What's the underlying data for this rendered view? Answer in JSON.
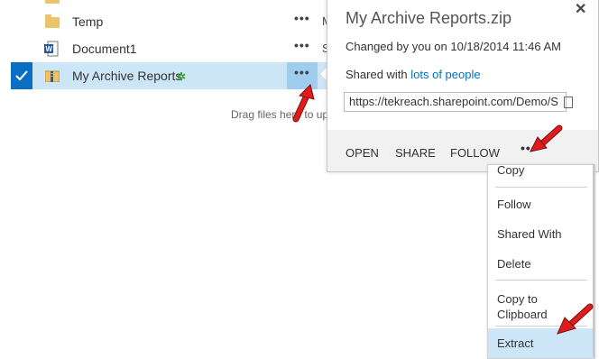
{
  "file_list": {
    "rows": [
      {
        "name": "Temp",
        "icon": "folder-icon",
        "clipped_col": ""
      },
      {
        "name": "Document1",
        "icon": "word-doc-icon",
        "clipped_col": "S"
      },
      {
        "name": "My Archive Reports",
        "icon": "zip-folder-icon",
        "clipped_col": ""
      }
    ],
    "temp_clip": "M",
    "row_menu_label": "•••",
    "drag_text": "Drag files here to up"
  },
  "callout": {
    "title": "My Archive Reports.zip",
    "close_label": "✕",
    "changed": "Changed by you on 10/18/2014 11:46 AM",
    "shared_prefix": "Shared with ",
    "shared_link": "lots of people",
    "url": "https://tekreach.sharepoint.com/Demo/S",
    "actions": {
      "open": "OPEN",
      "share": "SHARE",
      "follow": "FOLLOW",
      "more": "•••"
    }
  },
  "menu": {
    "items": [
      "Copy",
      "Follow",
      "Shared With",
      "Delete",
      "Copy to Clipboard",
      "Extract"
    ],
    "copy_to": "Copy to",
    "clipboard": "Clipboard"
  },
  "colors": {
    "selected_row": "#cde6f7",
    "check_blue": "#0a6fc2",
    "link": "#0072c6",
    "annotation_arrow": "#e01b1b"
  }
}
